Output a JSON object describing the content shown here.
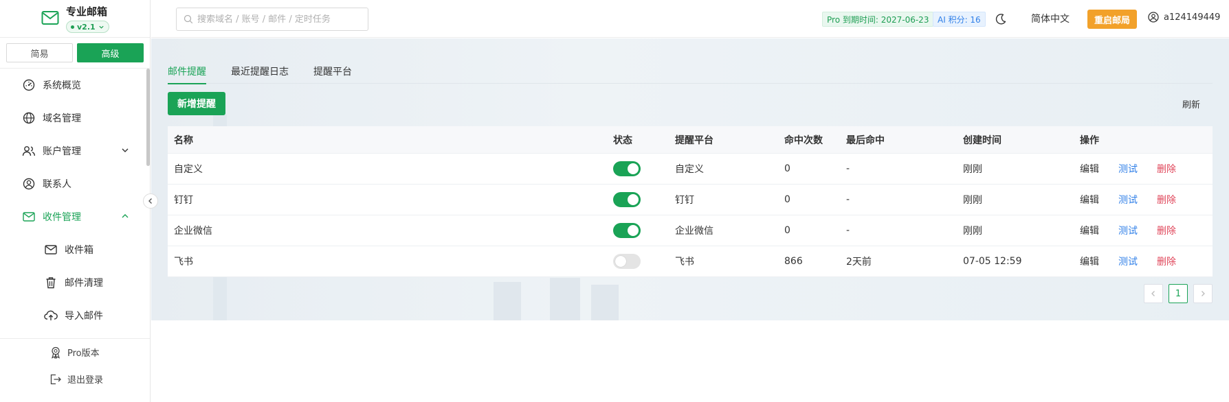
{
  "brand": {
    "title": "专业邮箱",
    "version": "v2.1"
  },
  "mode": {
    "simple": "简易",
    "advanced": "高级"
  },
  "menu": [
    {
      "label": "系统概览",
      "icon": "dashboard-icon"
    },
    {
      "label": "域名管理",
      "icon": "globe-icon"
    },
    {
      "label": "账户管理",
      "icon": "users-icon"
    },
    {
      "label": "联系人",
      "icon": "contact-icon"
    },
    {
      "label": "收件管理",
      "icon": "mail-icon"
    },
    {
      "label": "收件箱",
      "icon": "inbox-icon"
    },
    {
      "label": "邮件清理",
      "icon": "trash-icon"
    },
    {
      "label": "导入邮件",
      "icon": "cloud-upload-icon"
    }
  ],
  "footer": {
    "pro": "Pro版本",
    "logout": "退出登录"
  },
  "header": {
    "search_placeholder": "搜索域名 / 账号 / 邮件 / 定时任务",
    "pro_badge": "Pro 到期时间: 2027-06-23",
    "ai_badge": "AI 积分: 16",
    "language": "简体中文",
    "reboot": "重启邮局",
    "username": "a124149449"
  },
  "tabs": [
    "邮件提醒",
    "最近提醒日志",
    "提醒平台"
  ],
  "actions": {
    "add": "新增提醒",
    "refresh": "刷新"
  },
  "table": {
    "headers": [
      "名称",
      "状态",
      "提醒平台",
      "命中次数",
      "最后命中",
      "创建时间",
      "操作"
    ],
    "rows": [
      {
        "name": "自定义",
        "enabled": true,
        "platform": "自定义",
        "hits": "0",
        "last_hit": "-",
        "created": "刚刚"
      },
      {
        "name": "钉钉",
        "enabled": true,
        "platform": "钉钉",
        "hits": "0",
        "last_hit": "-",
        "created": "刚刚"
      },
      {
        "name": "企业微信",
        "enabled": true,
        "platform": "企业微信",
        "hits": "0",
        "last_hit": "-",
        "created": "刚刚"
      },
      {
        "name": "飞书",
        "enabled": false,
        "platform": "飞书",
        "hits": "866",
        "last_hit": "2天前",
        "created": "07-05 12:59"
      }
    ],
    "ops": {
      "edit": "编辑",
      "test": "测试",
      "delete": "删除"
    }
  },
  "pagination": {
    "current": "1"
  },
  "colors": {
    "primary": "#1aa356",
    "warning": "#f2a12a",
    "link": "#2f7fe8",
    "danger": "#e0465a"
  }
}
